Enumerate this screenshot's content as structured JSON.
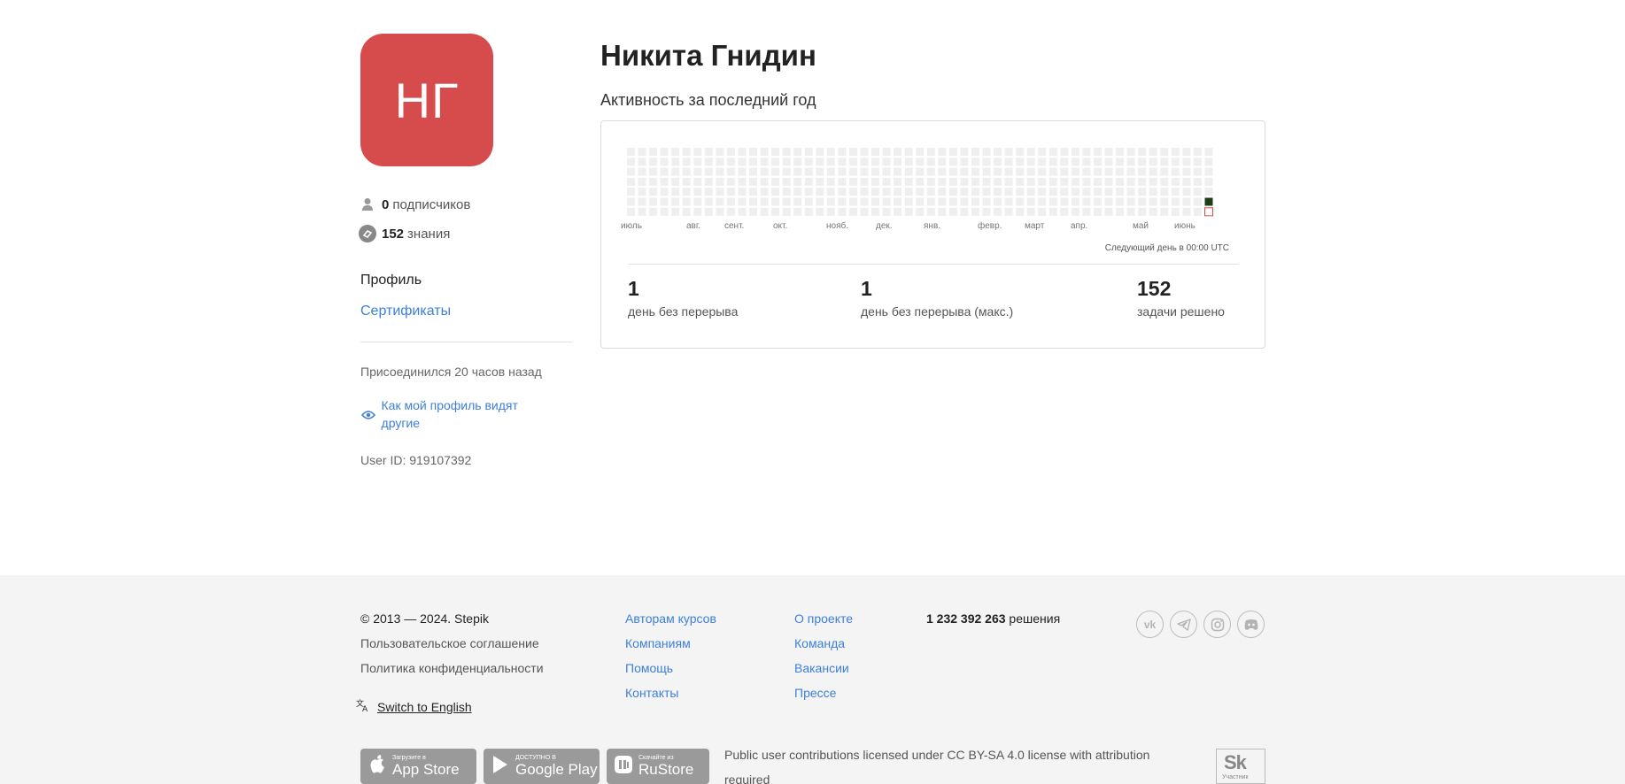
{
  "profile": {
    "initials": "НГ",
    "name": "Никита Гнидин",
    "followers_count": "0",
    "followers_label": "подписчиков",
    "knowledge_count": "152",
    "knowledge_label": "знания",
    "avatar_color": "#d64c4c"
  },
  "sidebar": {
    "profile_link": "Профиль",
    "certificates_link": "Сертификаты",
    "joined": "Присоединился 20 часов назад",
    "view_as_others": "Как мой профиль видят другие",
    "user_id": "User ID: 919107392"
  },
  "activity": {
    "title": "Активность за последний год",
    "months": [
      "июль",
      "авг.",
      "сент.",
      "окт.",
      "нояб.",
      "дек.",
      "янв.",
      "февр.",
      "март",
      "апр.",
      "май",
      "июнь"
    ],
    "next_day_note": "Следующий день в 00:00 UTC",
    "weeks": 53,
    "active_days": [
      {
        "week": 52,
        "day": 5,
        "level": "high"
      }
    ],
    "today": {
      "week": 52,
      "day": 6
    },
    "empty_color": "#efefef",
    "active_color": "#1e3d14",
    "today_outline_color": "#d64c4c"
  },
  "metrics": [
    {
      "value": "1",
      "label": "день без перерыва"
    },
    {
      "value": "1",
      "label": "день без перерыва (макс.)"
    },
    {
      "value": "152",
      "label": "задачи решено"
    }
  ],
  "footer": {
    "copyright": "© 2013 — 2024. Stepik",
    "terms": "Пользовательское соглашение",
    "privacy": "Политика конфиденциальности",
    "switch_language": "Switch to English",
    "col1": [
      "Авторам курсов",
      "Компаниям",
      "Помощь",
      "Контакты"
    ],
    "col2": [
      "О проекте",
      "Команда",
      "Вакансии",
      "Прессе"
    ],
    "solutions_count": "1 232 392 263",
    "solutions_label": "решения",
    "social": [
      {
        "icon": "vk-icon",
        "glyph": "vk"
      },
      {
        "icon": "telegram-icon",
        "glyph": "✈"
      },
      {
        "icon": "instagram-icon",
        "glyph": "◎"
      },
      {
        "icon": "discord-icon",
        "glyph": "◉"
      }
    ],
    "stores": [
      {
        "icon": "apple-icon",
        "small": "Загрузите в",
        "big": "App Store"
      },
      {
        "icon": "google-play-icon",
        "small": "ДОСТУПНО В",
        "big": "Google Play"
      },
      {
        "icon": "rustore-icon",
        "small": "Скачайте из",
        "big": "RuStore"
      }
    ],
    "license": "Public user contributions licensed under CC BY-SA 4.0 license with attribution required",
    "sk_logo": "Sk",
    "sk_label": "Участник"
  }
}
